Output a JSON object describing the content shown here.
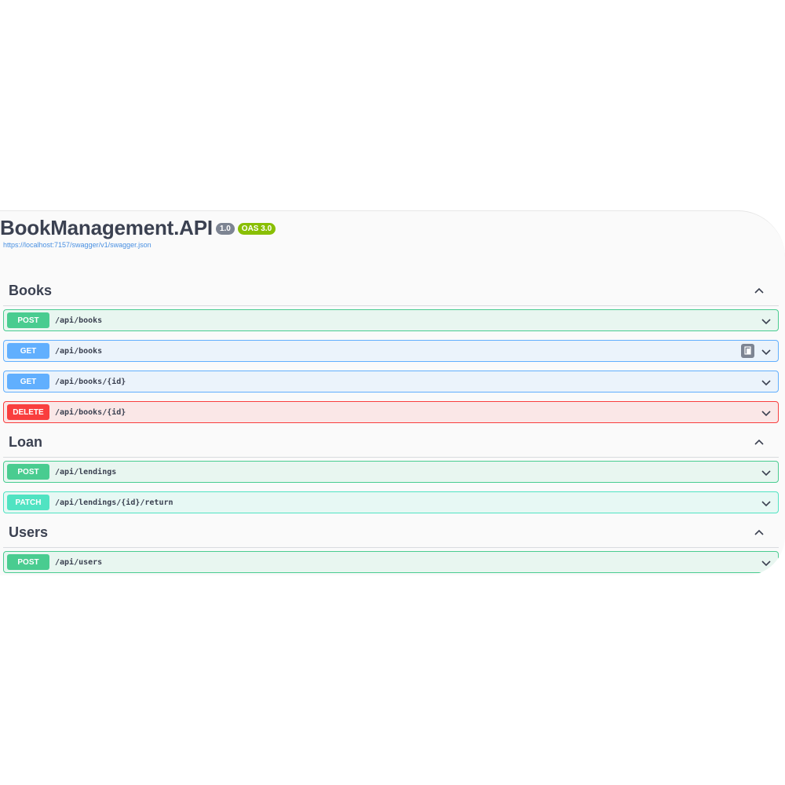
{
  "info": {
    "title": "BookManagement.API",
    "version_badge": "1.0",
    "oas_badge": "OAS 3.0",
    "spec_url": "https://localhost:7157/swagger/v1/swagger.json"
  },
  "sections": [
    {
      "name": "Books",
      "operations": [
        {
          "method": "POST",
          "path": "/api/books"
        },
        {
          "method": "GET",
          "path": "/api/books"
        },
        {
          "method": "GET",
          "path": "/api/books/{id}"
        },
        {
          "method": "DELETE",
          "path": "/api/books/{id}"
        }
      ]
    },
    {
      "name": "Loan",
      "operations": [
        {
          "method": "POST",
          "path": "/api/lendings"
        },
        {
          "method": "PATCH",
          "path": "/api/lendings/{id}/return"
        }
      ]
    },
    {
      "name": "Users",
      "operations": [
        {
          "method": "POST",
          "path": "/api/users"
        }
      ]
    }
  ],
  "colors": {
    "post": "#49cc90",
    "get": "#61affe",
    "delete": "#f93e3e",
    "patch": "#50e3c2"
  },
  "icons": {
    "collapse": "chevron-up-icon",
    "expand": "chevron-down-icon",
    "copy": "copy-icon"
  }
}
